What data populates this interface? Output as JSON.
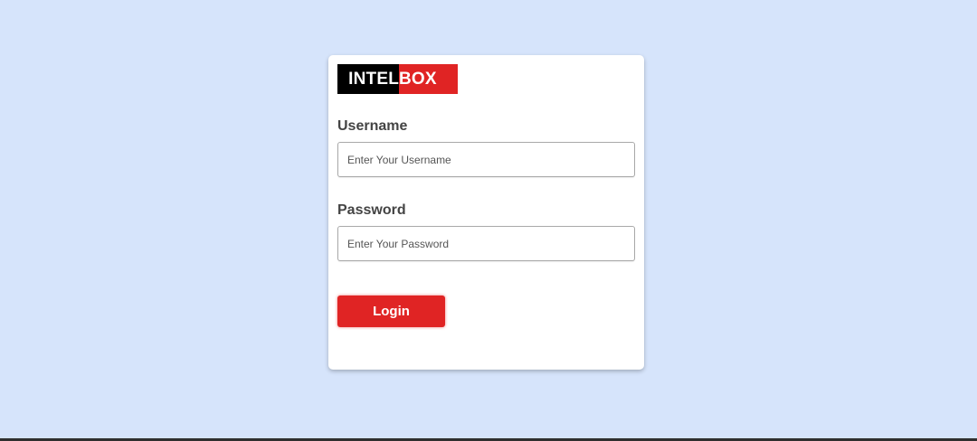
{
  "logo": {
    "part_a": "INTEL",
    "part_b": "BOX"
  },
  "form": {
    "username_label": "Username",
    "username_placeholder": "Enter Your Username",
    "password_label": "Password",
    "password_placeholder": "Enter Your Password",
    "login_label": "Login"
  },
  "colors": {
    "background": "#d6e4fb",
    "accent": "#e02424",
    "logo_dark": "#000000"
  }
}
